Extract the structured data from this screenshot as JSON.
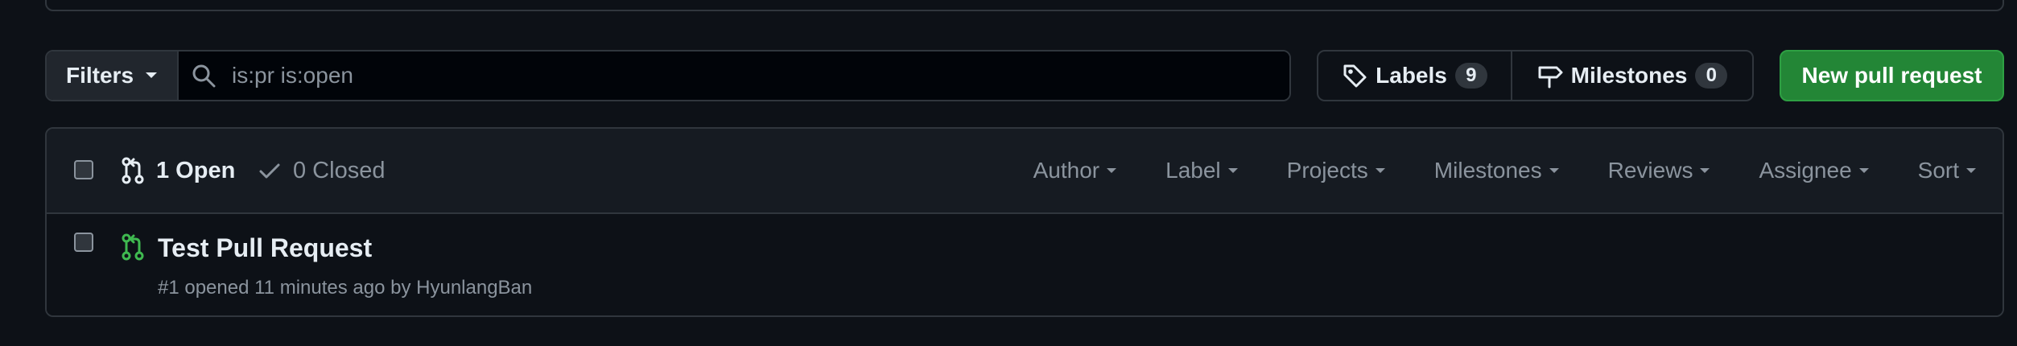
{
  "toolbar": {
    "filters_label": "Filters",
    "search_value": "is:pr is:open",
    "labels_label": "Labels",
    "labels_count": "9",
    "milestones_label": "Milestones",
    "milestones_count": "0",
    "new_pr_label": "New pull request"
  },
  "list_header": {
    "open_label": "1 Open",
    "closed_label": "0 Closed",
    "filters": [
      "Author",
      "Label",
      "Projects",
      "Milestones",
      "Reviews",
      "Assignee",
      "Sort"
    ]
  },
  "pull_requests": [
    {
      "title": "Test Pull Request",
      "meta_prefix": "#1 opened 11 minutes ago by",
      "author": "HyunlangBan"
    }
  ],
  "icons": {
    "search": "search-icon",
    "tag": "tag-icon",
    "milestone": "milestone-icon",
    "pull_request": "git-pull-request-icon",
    "check": "check-icon",
    "caret": "triangle-down-icon"
  },
  "colors": {
    "background": "#0d1117",
    "border": "#30363d",
    "primary_button": "#238636",
    "open_pr_icon": "#3fb950",
    "muted_text": "#8b949e"
  }
}
